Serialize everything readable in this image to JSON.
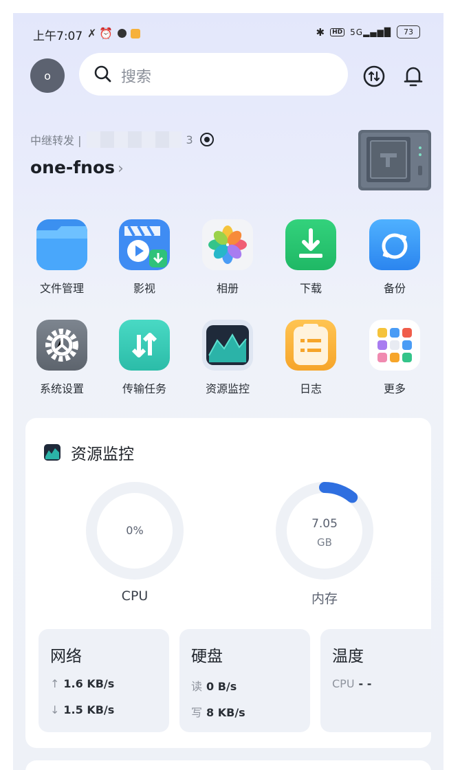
{
  "status_bar": {
    "time": "上午7:07",
    "battery": "73",
    "network": "5G"
  },
  "header": {
    "avatar_letter": "o",
    "search_placeholder": "搜索"
  },
  "device": {
    "connection_label": "中继转发 | ",
    "masked_id_suffix": "3",
    "name": "one-fnos",
    "chevron": "›"
  },
  "apps": [
    {
      "label": "文件管理",
      "icon": "folder-icon"
    },
    {
      "label": "影视",
      "icon": "film-icon"
    },
    {
      "label": "相册",
      "icon": "photos-icon"
    },
    {
      "label": "下载",
      "icon": "download-icon"
    },
    {
      "label": "备份",
      "icon": "backup-icon"
    },
    {
      "label": "系统设置",
      "icon": "settings-gear-icon"
    },
    {
      "label": "传输任务",
      "icon": "transfer-icon"
    },
    {
      "label": "资源监控",
      "icon": "resource-monitor-icon"
    },
    {
      "label": "日志",
      "icon": "log-icon"
    },
    {
      "label": "更多",
      "icon": "more-apps-icon"
    }
  ],
  "resource_monitor": {
    "title": "资源监控",
    "cpu": {
      "value": "0%",
      "label": "CPU",
      "usage_fraction": 0.0
    },
    "memory": {
      "value": "7.05",
      "unit": "GB",
      "label": "内存",
      "usage_fraction": 0.11
    },
    "network": {
      "title": "网络",
      "up_label": "↑",
      "up": "1.6 KB/s",
      "down_label": "↓",
      "down": "1.5 KB/s"
    },
    "disk": {
      "title": "硬盘",
      "read_label": "读",
      "read": "0 B/s",
      "write_label": "写",
      "write": "8 KB/s"
    },
    "temperature": {
      "title": "温度",
      "cpu_label": "CPU",
      "cpu_value": "-  -"
    }
  },
  "colors": {
    "accent": "#2f6fe0",
    "gauge_track": "#eef1f6"
  }
}
